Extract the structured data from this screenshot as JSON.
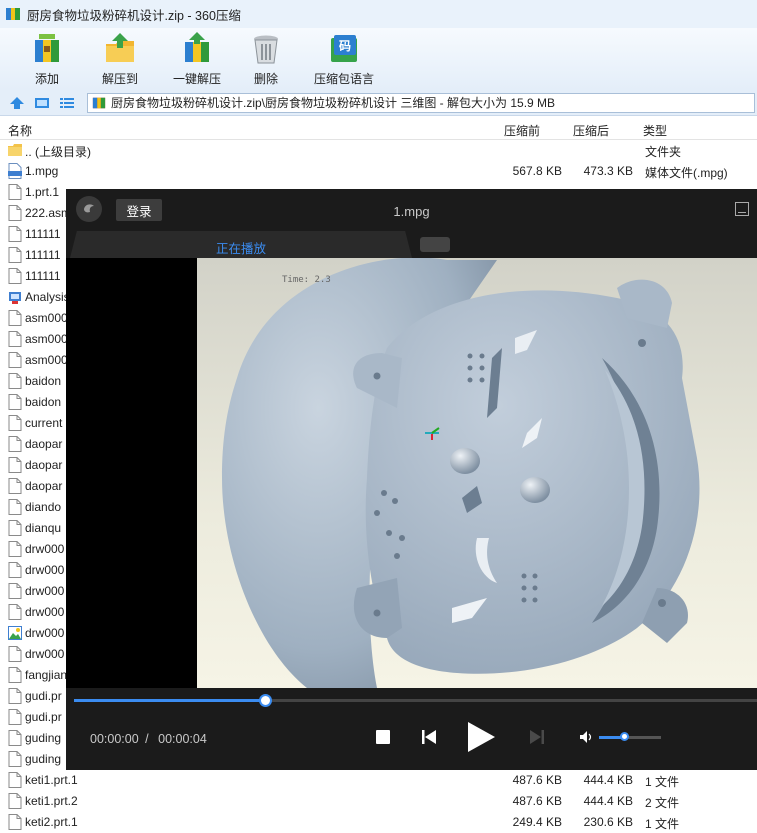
{
  "window": {
    "title": "厨房食物垃圾粉碎机设计.zip - 360压缩"
  },
  "toolbar": {
    "buttons": [
      {
        "label": "添加",
        "icon": "add-archive-icon"
      },
      {
        "label": "解压到",
        "icon": "extract-to-icon"
      },
      {
        "label": "一键解压",
        "icon": "one-click-extract-icon"
      },
      {
        "label": "删除",
        "icon": "delete-trash-icon"
      },
      {
        "label": "压缩包语言",
        "icon": "archive-language-icon"
      }
    ]
  },
  "address": {
    "path": "厨房食物垃圾粉碎机设计.zip\\厨房食物垃圾粉碎机设计 三维图 - 解包大小为 15.9 MB"
  },
  "columns": {
    "name": "名称",
    "before": "压缩前",
    "after": "压缩后",
    "type": "类型"
  },
  "files": [
    {
      "name": ".. (上级目录)",
      "before": "",
      "after": "",
      "type": "文件夹",
      "icon": "folder"
    },
    {
      "name": "1.mpg",
      "before": "567.8 KB",
      "after": "473.3 KB",
      "type": "媒体文件(.mpg)",
      "icon": "mpg"
    },
    {
      "name": "1.prt.1",
      "before": "",
      "after": "",
      "type": "",
      "icon": "doc"
    },
    {
      "name": "222.asm",
      "before": "",
      "after": "",
      "type": "",
      "icon": "doc"
    },
    {
      "name": "111111",
      "before": "",
      "after": "",
      "type": "",
      "icon": "doc"
    },
    {
      "name": "111111",
      "before": "",
      "after": "",
      "type": "",
      "icon": "doc"
    },
    {
      "name": "111111",
      "before": "",
      "after": "",
      "type": "",
      "icon": "doc"
    },
    {
      "name": "Analysis",
      "before": "",
      "after": "",
      "type": "",
      "icon": "app"
    },
    {
      "name": "asm000",
      "before": "",
      "after": "",
      "type": "",
      "icon": "doc"
    },
    {
      "name": "asm000",
      "before": "",
      "after": "",
      "type": "",
      "icon": "doc"
    },
    {
      "name": "asm000",
      "before": "",
      "after": "",
      "type": "",
      "icon": "doc"
    },
    {
      "name": "baidon",
      "before": "",
      "after": "",
      "type": "",
      "icon": "doc"
    },
    {
      "name": "baidon",
      "before": "",
      "after": "",
      "type": "",
      "icon": "doc"
    },
    {
      "name": "current",
      "before": "",
      "after": "",
      "type": "",
      "icon": "doc"
    },
    {
      "name": "daopar",
      "before": "",
      "after": "",
      "type": "",
      "icon": "doc"
    },
    {
      "name": "daopar",
      "before": "",
      "after": "",
      "type": "",
      "icon": "doc"
    },
    {
      "name": "daopar",
      "before": "",
      "after": "",
      "type": "",
      "icon": "doc"
    },
    {
      "name": "diando",
      "before": "",
      "after": "",
      "type": "",
      "icon": "doc"
    },
    {
      "name": "dianqu",
      "before": "",
      "after": "",
      "type": "",
      "icon": "doc"
    },
    {
      "name": "drw000",
      "before": "",
      "after": "",
      "type": "",
      "icon": "doc"
    },
    {
      "name": "drw000",
      "before": "",
      "after": "",
      "type": "",
      "icon": "doc"
    },
    {
      "name": "drw000",
      "before": "",
      "after": "",
      "type": "",
      "icon": "doc"
    },
    {
      "name": "drw000",
      "before": "",
      "after": "",
      "type": "",
      "icon": "doc"
    },
    {
      "name": "drw000",
      "before": "",
      "after": "",
      "type": "",
      "icon": "img"
    },
    {
      "name": "drw000",
      "before": "",
      "after": "",
      "type": "",
      "icon": "doc"
    },
    {
      "name": "fangjian",
      "before": "",
      "after": "",
      "type": "",
      "icon": "doc"
    },
    {
      "name": "gudi.pr",
      "before": "",
      "after": "",
      "type": "",
      "icon": "doc"
    },
    {
      "name": "gudi.pr",
      "before": "",
      "after": "",
      "type": "",
      "icon": "doc"
    },
    {
      "name": "guding",
      "before": "",
      "after": "",
      "type": "",
      "icon": "doc"
    },
    {
      "name": "guding",
      "before": "",
      "after": "",
      "type": "",
      "icon": "doc"
    },
    {
      "name": "keti1.prt.1",
      "before": "487.6 KB",
      "after": "444.4 KB",
      "type": "1 文件",
      "icon": "doc"
    },
    {
      "name": "keti1.prt.2",
      "before": "487.6 KB",
      "after": "444.4 KB",
      "type": "2 文件",
      "icon": "doc"
    },
    {
      "name": "keti2.prt.1",
      "before": "249.4 KB",
      "after": "230.6 KB",
      "type": "1 文件",
      "icon": "doc"
    }
  ],
  "player": {
    "login_label": "登录",
    "title": "1.mpg",
    "tab_label": "正在播放",
    "video_overlay_text": "Time: 2.3",
    "time_current": "00:00:00",
    "time_sep": "/",
    "time_total": "00:00:04",
    "progress": 0.28,
    "volume": 0.4,
    "colors": {
      "accent": "#3b8cf0",
      "bg": "#1b1b1b"
    }
  }
}
